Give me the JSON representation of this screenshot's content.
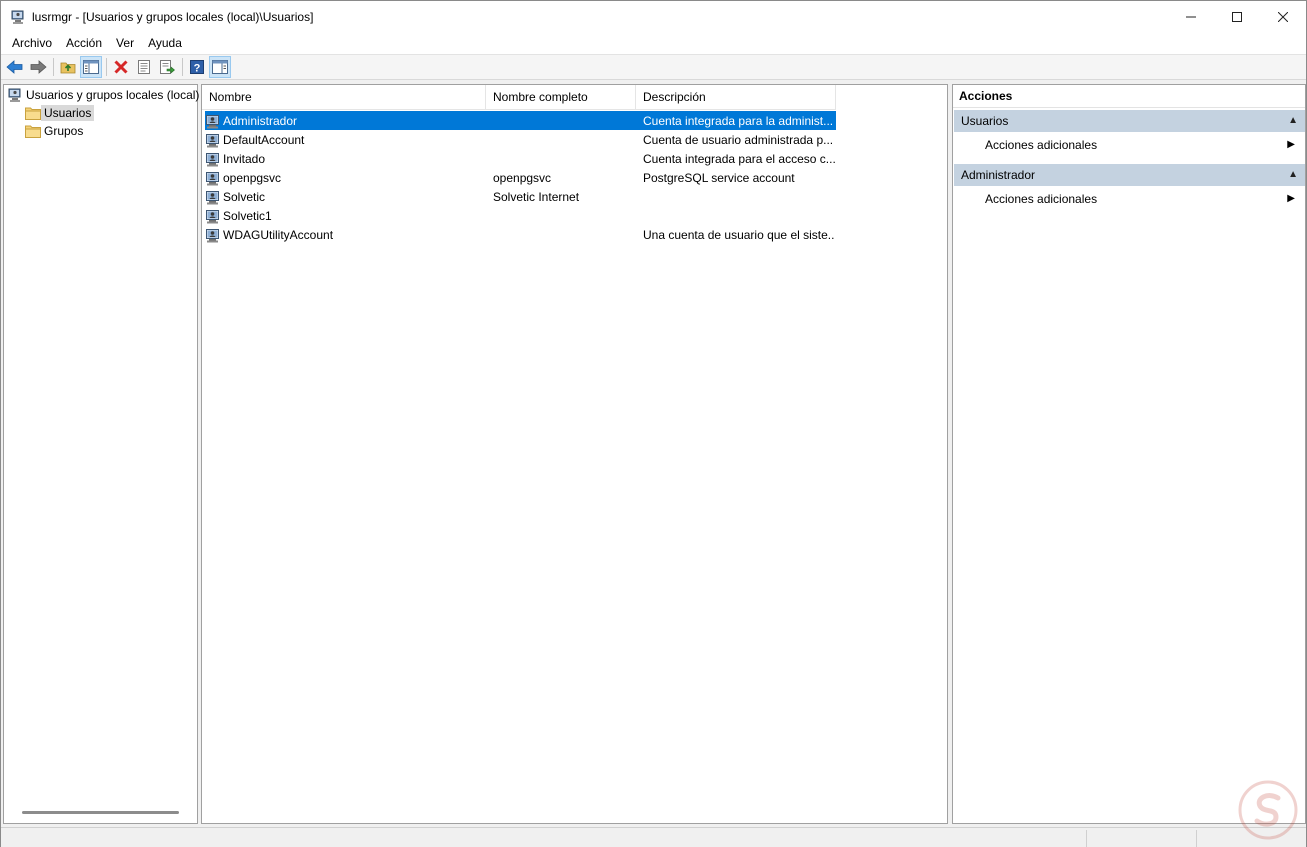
{
  "window": {
    "title": "lusrmgr - [Usuarios y grupos locales (local)\\Usuarios]",
    "minimize_glyph": "—",
    "maximize_glyph": "☐",
    "close_glyph": "✕"
  },
  "menu": {
    "items": [
      "Archivo",
      "Acción",
      "Ver",
      "Ayuda"
    ]
  },
  "toolbar": {
    "buttons": [
      "back-arrow-icon",
      "forward-arrow-icon",
      "up-folder-icon",
      "show-hide-tree-icon",
      "delete-icon",
      "properties-icon",
      "export-list-icon",
      "help-icon",
      "show-hide-action-pane-icon"
    ]
  },
  "tree": {
    "root": "Usuarios y grupos locales (local)",
    "children": [
      "Usuarios",
      "Grupos"
    ],
    "selected": "Usuarios"
  },
  "list": {
    "columns": [
      "Nombre",
      "Nombre completo",
      "Descripción"
    ],
    "rows": [
      {
        "name": "Administrador",
        "full_name": "",
        "description": "Cuenta integrada para la administ..."
      },
      {
        "name": "DefaultAccount",
        "full_name": "",
        "description": "Cuenta de usuario administrada p..."
      },
      {
        "name": "Invitado",
        "full_name": "",
        "description": "Cuenta integrada para el acceso c..."
      },
      {
        "name": "openpgsvc",
        "full_name": "openpgsvc",
        "description": "PostgreSQL service account"
      },
      {
        "name": "Solvetic",
        "full_name": "Solvetic Internet",
        "description": ""
      },
      {
        "name": "Solvetic1",
        "full_name": "",
        "description": ""
      },
      {
        "name": "WDAGUtilityAccount",
        "full_name": "",
        "description": "Una cuenta de usuario que el siste..."
      }
    ],
    "selected_row": 0
  },
  "actions": {
    "title": "Acciones",
    "sections": [
      {
        "header": "Usuarios",
        "item": "Acciones adicionales"
      },
      {
        "header": "Administrador",
        "item": "Acciones adicionales"
      }
    ]
  },
  "colors": {
    "selection": "#0078d7",
    "section_header": "#c4d2e0"
  }
}
